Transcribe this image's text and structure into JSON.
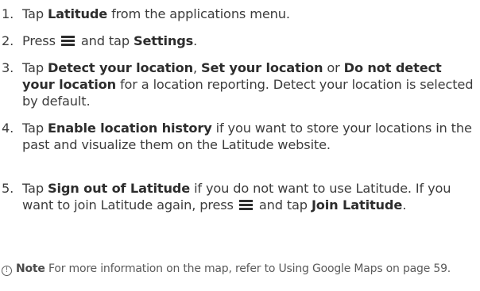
{
  "steps": [
    {
      "num": "1.",
      "parts": [
        {
          "t": "Tap "
        },
        {
          "t": "Latitude",
          "b": true
        },
        {
          "t": " from the applications menu."
        }
      ]
    },
    {
      "num": "2.",
      "parts": [
        {
          "t": "Press "
        },
        {
          "icon": "menu-icon"
        },
        {
          "t": " and tap "
        },
        {
          "t": "Settings",
          "b": true
        },
        {
          "t": "."
        }
      ]
    },
    {
      "num": "3.",
      "parts": [
        {
          "t": "Tap "
        },
        {
          "t": "Detect your location",
          "b": true
        },
        {
          "t": ", "
        },
        {
          "t": "Set your location",
          "b": true
        },
        {
          "t": " or "
        },
        {
          "t": "Do not detect your location",
          "b": true
        },
        {
          "t": " for a location reporting. Detect your location is selected by default."
        }
      ]
    },
    {
      "num": "4.",
      "parts": [
        {
          "t": "Tap "
        },
        {
          "t": "Enable location history",
          "b": true
        },
        {
          "t": " if you want to store your locations in the past and visualize them on the Latitude website."
        }
      ]
    },
    {
      "num": "5.",
      "parts": [
        {
          "t": "Tap "
        },
        {
          "t": "Sign out of Latitude",
          "b": true
        },
        {
          "t": " if you do not want to use Latitude. If you want to join Latitude again, press "
        },
        {
          "icon": "menu-icon"
        },
        {
          "t": " and tap "
        },
        {
          "t": "Join Latitude",
          "b": true
        },
        {
          "t": "."
        }
      ]
    }
  ],
  "note": {
    "icon_glyph": "!",
    "label": "Note",
    "text": " For more information on the map, refer to Using Google Maps on page 59."
  }
}
